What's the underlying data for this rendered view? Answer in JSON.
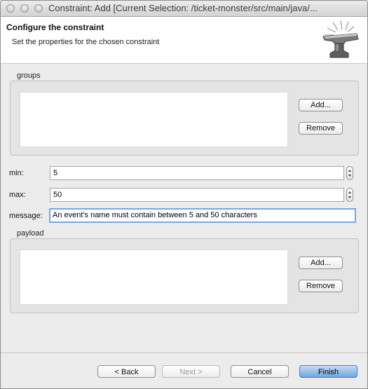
{
  "window": {
    "title": "Constraint: Add [Current Selection: /ticket-monster/src/main/java/..."
  },
  "banner": {
    "title": "Configure the constraint",
    "description": "Set the properties for the chosen constraint",
    "icon": "anvil-icon"
  },
  "groups": {
    "label": "groups",
    "add_label": "Add...",
    "remove_label": "Remove"
  },
  "fields": {
    "min_label": "min:",
    "min_value": "5",
    "max_label": "max:",
    "max_value": "50",
    "message_label": "message:",
    "message_value": "An event's name must contain between 5 and 50 characters"
  },
  "payload": {
    "label": "payload",
    "add_label": "Add...",
    "remove_label": "Remove"
  },
  "buttons": {
    "back": "< Back",
    "next": "Next >",
    "cancel": "Cancel",
    "finish": "Finish"
  },
  "colors": {
    "default_button": "#6fa6e4",
    "focus_ring": "#7aa7e0"
  }
}
